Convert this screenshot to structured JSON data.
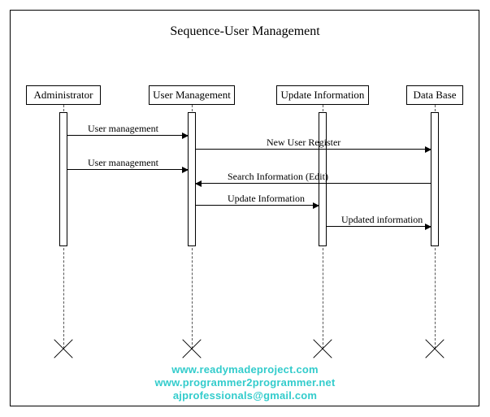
{
  "title": "Sequence-User Management",
  "participants": {
    "admin": "Administrator",
    "user_mgmt": "User Management",
    "update_info": "Update Information",
    "database": "Data Base"
  },
  "messages": {
    "m1": "User management",
    "m2": "New User Register",
    "m3": "User management",
    "m4": "Search Information (Edit)",
    "m5": "Update Information",
    "m6": "Updated information"
  },
  "watermark": {
    "line1": "www.readymadeproject.com",
    "line2": "www.programmer2programmer.net",
    "line3": "ajprofessionals@gmail.com"
  }
}
